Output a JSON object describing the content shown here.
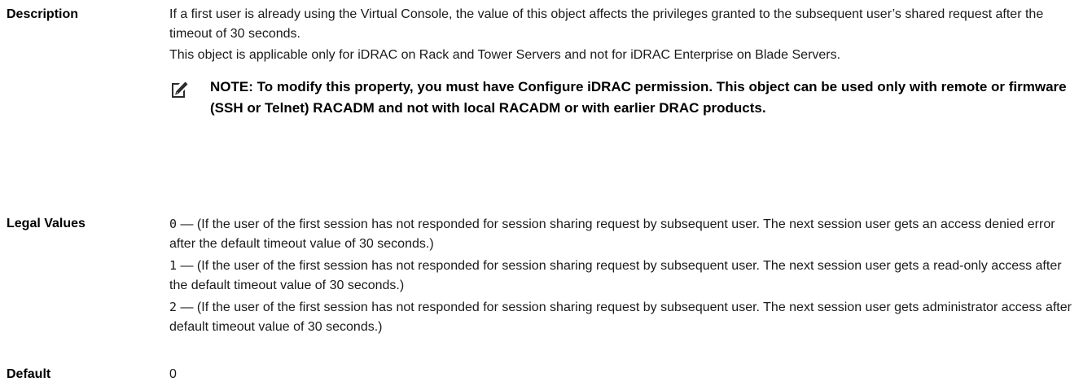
{
  "description": {
    "label": "Description",
    "paragraphs": [
      "If a first user is already using the Virtual Console, the value of this object affects the privileges granted to the subsequent user’s shared request after the timeout of 30 seconds.",
      "This object is applicable only for iDRAC on Rack and Tower Servers and not for iDRAC Enterprise on Blade Servers."
    ],
    "note": {
      "icon": "pencil-note-icon",
      "text": "NOTE: To modify this property, you must have Configure iDRAC permission. This object can be used only with remote or firmware (SSH or Telnet) RACADM and not with local RACADM or with earlier DRAC products."
    }
  },
  "legal_values": {
    "label": "Legal Values",
    "items": [
      {
        "code": "0",
        "text": " — (If the user of the first session has not responded for session sharing request by subsequent user. The next session user gets an access denied error after the default timeout value of 30 seconds.)"
      },
      {
        "code": "1",
        "text": " — (If the user of the first session has not responded for session sharing request by subsequent user. The next session user gets a read-only access after the default timeout value of 30 seconds.)"
      },
      {
        "code": "2",
        "text": " — (If the user of the first session has not responded for session sharing request by subsequent user. The next session user gets administrator access after default timeout value of 30 seconds.)"
      }
    ]
  },
  "default": {
    "label": "Default",
    "value": "0"
  }
}
